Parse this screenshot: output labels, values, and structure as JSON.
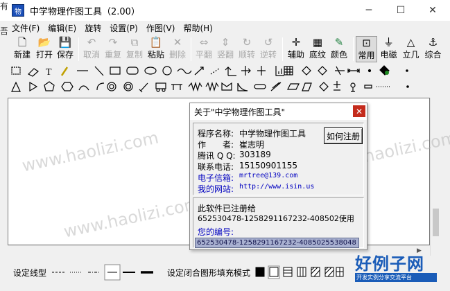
{
  "window": {
    "title": "中学物理作图工具（2.00）"
  },
  "edge": {
    "top_chars": "有",
    "side_char": "吾"
  },
  "menu": [
    "文件(F)",
    "编辑(E)",
    "旋转",
    "设置(P)",
    "作图(V)",
    "帮助(H)"
  ],
  "toolbar": {
    "file": [
      "新建",
      "打开",
      "保存"
    ],
    "edit": [
      "取消",
      "重复",
      "复制",
      "粘贴",
      "删除"
    ],
    "transform": [
      "平翻",
      "竖翻",
      "顺转",
      "逆转"
    ],
    "view": [
      "辅助",
      "底纹",
      "颜色"
    ],
    "modes": [
      "常用",
      "电磁",
      "立几",
      "综合"
    ]
  },
  "bottom": {
    "line_label": "设定线型",
    "fill_label": "设定闭合图形填充模式"
  },
  "dialog": {
    "title": "关于\"中学物理作图工具\"",
    "close": "✕",
    "register_button": "如何注册",
    "fields": [
      {
        "key": "程序名称:",
        "value": "中学物理作图工具"
      },
      {
        "key": "作　　者:",
        "value": "崔志明"
      },
      {
        "key": "腾讯 Q Q:",
        "value": "303189"
      },
      {
        "key": "联系电话:",
        "value": "15150901155"
      },
      {
        "key": "电子信箱:",
        "value": "mrtree@139.com"
      },
      {
        "key": "我的网站:",
        "value": "http://www.isin.us"
      }
    ],
    "registered_label": "此软件已注册给",
    "registered_to": "652530478-1258291167232-408502使用",
    "serial_label": "您的编号:",
    "serial_value": "652530478-1258291167232-4085025538048"
  },
  "watermark": "www.haolizi.com",
  "logo": {
    "title": "好例子网",
    "subtitle": "开发实例分享交流平台"
  }
}
